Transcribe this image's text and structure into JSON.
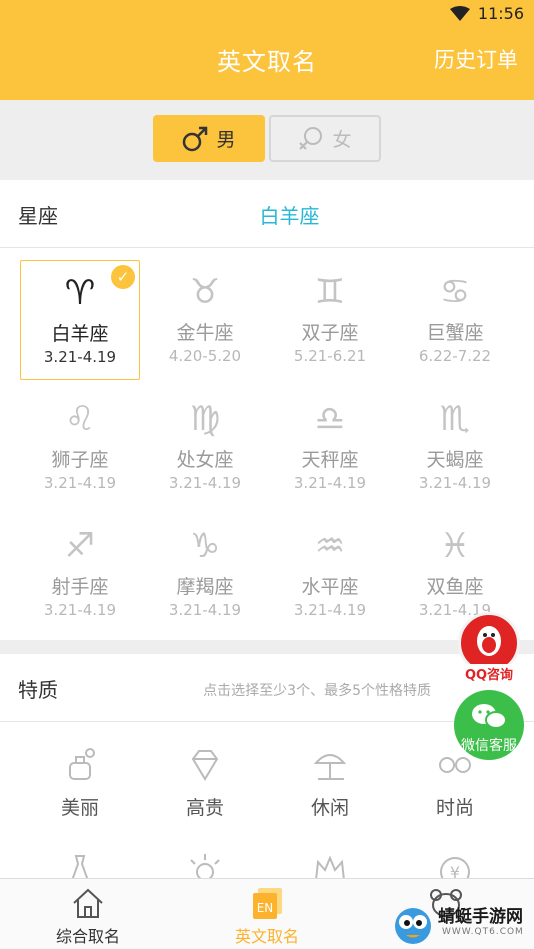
{
  "status_bar": {
    "time": "11:56",
    "icon": "wifi-icon"
  },
  "header": {
    "title": "英文取名",
    "right_action": "历史订单"
  },
  "gender": {
    "male": {
      "label": "男",
      "icon": "male-symbol-icon",
      "selected": true
    },
    "female": {
      "label": "女",
      "icon": "female-symbol-icon",
      "selected": false
    }
  },
  "constellation": {
    "label": "星座",
    "selected_value": "白羊座"
  },
  "zodiac": [
    {
      "symbol": "♈",
      "name": "白羊座",
      "date": "3.21-4.19",
      "selected": true
    },
    {
      "symbol": "♉",
      "name": "金牛座",
      "date": "4.20-5.20",
      "selected": false
    },
    {
      "symbol": "♊",
      "name": "双子座",
      "date": "5.21-6.21",
      "selected": false
    },
    {
      "symbol": "♋",
      "name": "巨蟹座",
      "date": "6.22-7.22",
      "selected": false
    },
    {
      "symbol": "♌",
      "name": "狮子座",
      "date": "3.21-4.19",
      "selected": false
    },
    {
      "symbol": "♍",
      "name": "处女座",
      "date": "3.21-4.19",
      "selected": false
    },
    {
      "symbol": "♎",
      "name": "天秤座",
      "date": "3.21-4.19",
      "selected": false
    },
    {
      "symbol": "♏",
      "name": "天蝎座",
      "date": "3.21-4.19",
      "selected": false
    },
    {
      "symbol": "♐",
      "name": "射手座",
      "date": "3.21-4.19",
      "selected": false
    },
    {
      "symbol": "♑",
      "name": "摩羯座",
      "date": "3.21-4.19",
      "selected": false
    },
    {
      "symbol": "♒",
      "name": "水平座",
      "date": "3.21-4.19",
      "selected": false
    },
    {
      "symbol": "♓",
      "name": "双鱼座",
      "date": "3.21-4.19",
      "selected": false
    }
  ],
  "traits_section": {
    "label": "特质",
    "hint": "点击选择至少3个、最多5个性格特质"
  },
  "traits": [
    {
      "label": "美丽",
      "icon": "perfume-icon"
    },
    {
      "label": "高贵",
      "icon": "diamond-icon"
    },
    {
      "label": "休闲",
      "icon": "beach-umbrella-icon"
    },
    {
      "label": "时尚",
      "icon": "glasses-icon"
    }
  ],
  "traits_row2_icons": [
    "dress-icon",
    "sun-icon",
    "crown-icon",
    "money-icon"
  ],
  "float_buttons": {
    "qq": "QQ咨询",
    "wechat": "微信客服"
  },
  "bottom_nav": [
    {
      "label": "综合取名",
      "icon": "home-icon",
      "active": false
    },
    {
      "label": "英文取名",
      "icon": "en-icon",
      "active": true
    },
    {
      "label": "",
      "icon": "bear-icon",
      "active": false
    }
  ],
  "watermark": {
    "title": "蜻蜓手游网",
    "sub": "WWW.QT6.COM"
  },
  "colors": {
    "accent": "#fcc33c",
    "selected_text": "#29b7d6",
    "qq": "#e02424",
    "wechat": "#3cbf4a"
  }
}
